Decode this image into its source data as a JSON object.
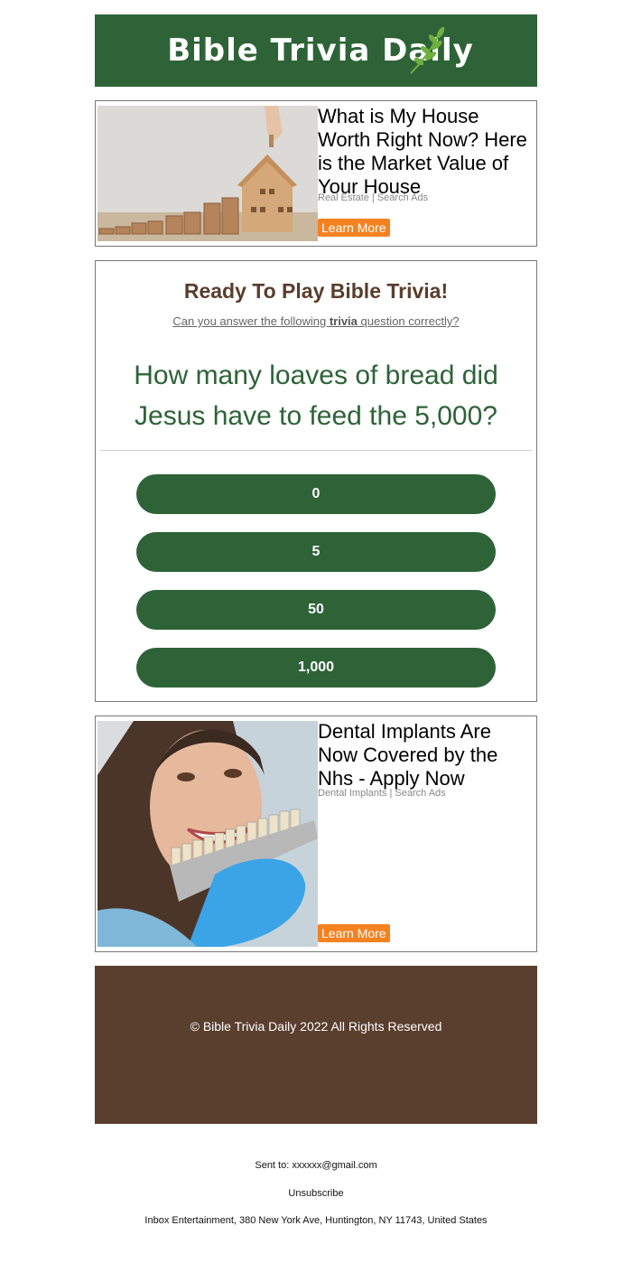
{
  "header": {
    "logo_text": "Bible Trivia Daily"
  },
  "ads": [
    {
      "title": "What is My House Worth Right Now? Here is the Market Value of Your House",
      "meta": "Real Estate | Search Ads",
      "button": "Learn More"
    },
    {
      "title": "Dental Implants Are Now Covered by the Nhs - Apply Now",
      "meta": "Dental Implants | Search Ads",
      "button": "Learn More"
    }
  ],
  "quiz": {
    "heading": "Ready To Play Bible Trivia!",
    "sub_before": "Can you answer the following ",
    "sub_bold": "trivia",
    "sub_after": " question correctly?",
    "question": "How many loaves of bread did Jesus have to feed the 5,000?",
    "answers": [
      "0",
      "5",
      "50",
      "1,000"
    ]
  },
  "footer": {
    "copyright": "© Bible Trivia Daily 2022 All Rights Reserved"
  },
  "bottom": {
    "sent_to": "Sent to: xxxxxx@gmail.com",
    "unsubscribe": "Unsubscribe",
    "address": "Inbox Entertainment, 380 New York Ave, Huntington, NY 11743, United States"
  },
  "colors": {
    "brand_green": "#2d6337",
    "brand_brown": "#5a3f2f",
    "cta_orange": "#f58220"
  }
}
